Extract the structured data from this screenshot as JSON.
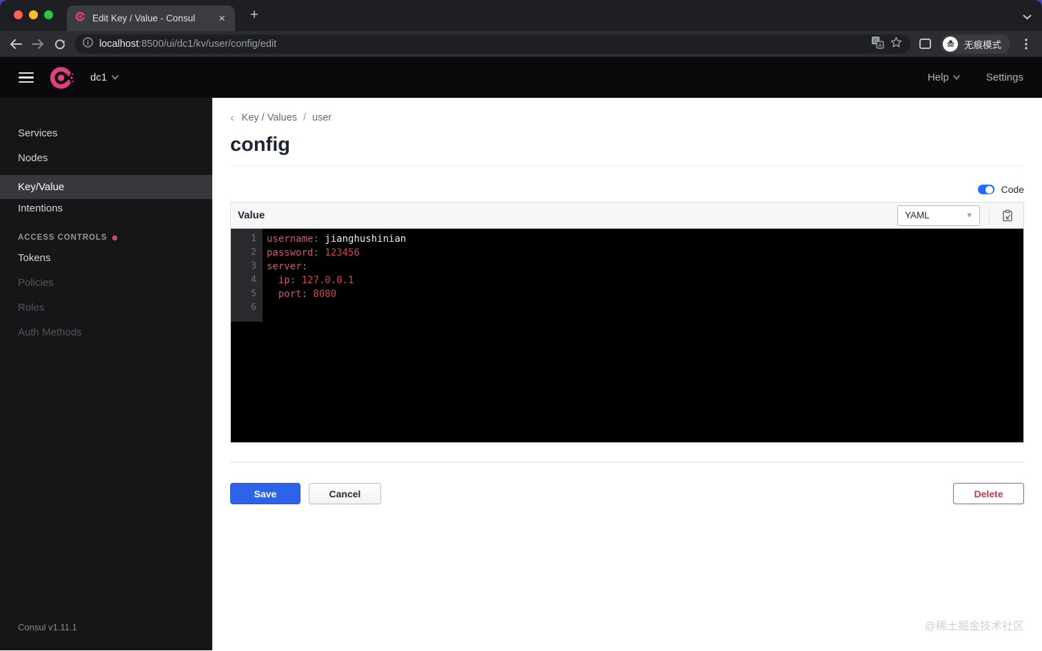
{
  "browser": {
    "tab": {
      "title": "Edit Key / Value - Consul"
    },
    "url": {
      "host": "localhost",
      "path": ":8500/ui/dc1/kv/user/config/edit"
    },
    "incognito_label": "无痕模式"
  },
  "topnav": {
    "datacenter": "dc1",
    "help_label": "Help",
    "settings_label": "Settings"
  },
  "sidebar": {
    "items": [
      {
        "label": "Services",
        "active": false
      },
      {
        "label": "Nodes",
        "active": false
      },
      {
        "label": "Key/Value",
        "active": true
      },
      {
        "label": "Intentions",
        "active": false
      }
    ],
    "section": {
      "header": "ACCESS CONTROLS",
      "items": [
        {
          "label": "Tokens",
          "muted": false
        },
        {
          "label": "Policies",
          "muted": true
        },
        {
          "label": "Roles",
          "muted": true
        },
        {
          "label": "Auth Methods",
          "muted": true
        }
      ]
    },
    "footer_version": "Consul v1.11.1"
  },
  "content": {
    "breadcrumb": {
      "back_chevron": "‹",
      "parent": "Key / Values",
      "separator": "/",
      "current": "user"
    },
    "page_title": "config",
    "code_toggle_label": "Code",
    "value_panel": {
      "label": "Value",
      "format_selected": "YAML"
    },
    "actions": {
      "save": "Save",
      "cancel": "Cancel",
      "delete": "Delete"
    }
  },
  "editor": {
    "lines": [
      {
        "number": "1",
        "tokens": [
          {
            "text": "username",
            "type": "key"
          },
          {
            "text": ":",
            "type": "colon"
          },
          {
            "text": " jianghushinian",
            "type": "str"
          }
        ]
      },
      {
        "number": "2",
        "tokens": [
          {
            "text": "password",
            "type": "key"
          },
          {
            "text": ":",
            "type": "colon"
          },
          {
            "text": " 123456",
            "type": "num"
          }
        ]
      },
      {
        "number": "3",
        "tokens": [
          {
            "text": "server",
            "type": "key"
          },
          {
            "text": ":",
            "type": "colon"
          }
        ]
      },
      {
        "number": "4",
        "tokens": [
          {
            "text": "  ",
            "type": "plain"
          },
          {
            "text": "ip",
            "type": "key"
          },
          {
            "text": ":",
            "type": "colon"
          },
          {
            "text": " 127.0.0.1",
            "type": "num"
          }
        ]
      },
      {
        "number": "5",
        "tokens": [
          {
            "text": "  ",
            "type": "plain"
          },
          {
            "text": "port",
            "type": "key"
          },
          {
            "text": ":",
            "type": "colon"
          },
          {
            "text": " 8080",
            "type": "num"
          }
        ]
      },
      {
        "number": "6",
        "tokens": []
      }
    ]
  },
  "watermark": "@稀土掘金技术社区",
  "colors": {
    "consul_pink": "#e0407e",
    "save_blue": "#2d63e8",
    "toggle_blue": "#1f6cff",
    "delete_red": "#c03a48",
    "acl_status_dot": "#ee5470",
    "syntax_key": "#ce5a66",
    "syntax_colon": "#4fae96",
    "syntax_string": "#ededee",
    "syntax_number": "#d4454f"
  }
}
